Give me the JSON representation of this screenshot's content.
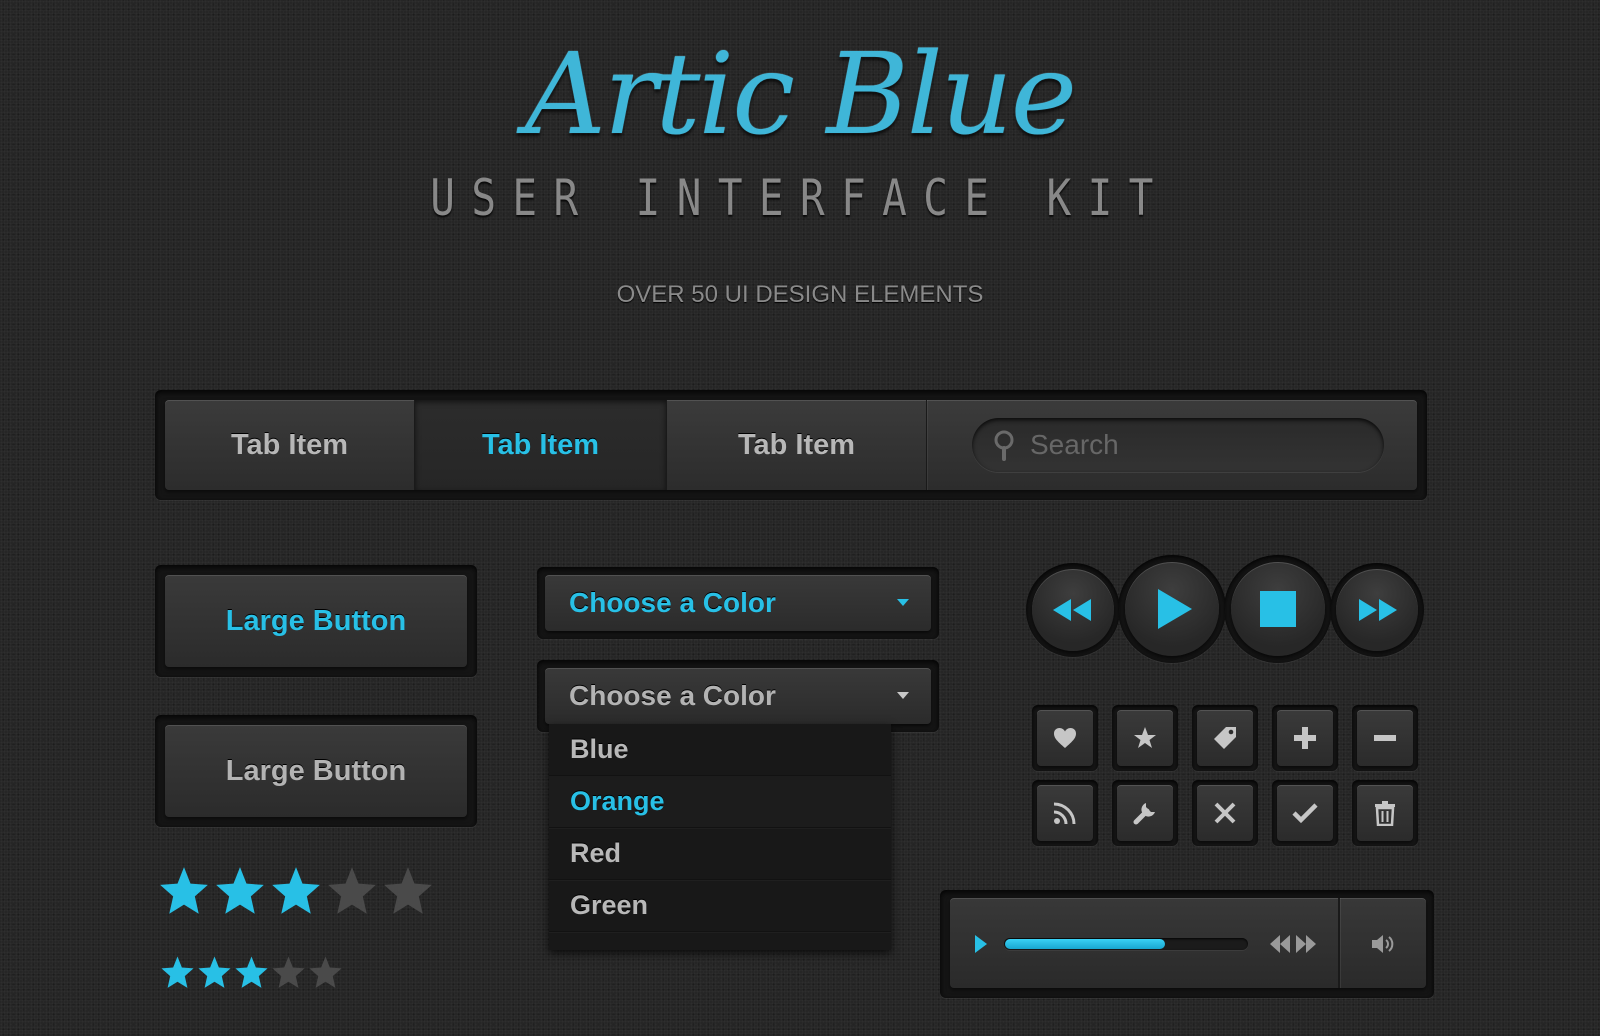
{
  "header": {
    "title": "Artic Blue",
    "subtitle": "USER INTERFACE KIT",
    "tagline": "OVER 50 UI DESIGN ELEMENTS"
  },
  "tabbar": {
    "tabs": [
      {
        "label": "Tab Item",
        "active": false
      },
      {
        "label": "Tab Item",
        "active": true
      },
      {
        "label": "Tab Item",
        "active": false
      }
    ],
    "search": {
      "placeholder": "Search",
      "value": "",
      "icon": "search-icon"
    }
  },
  "buttons": {
    "primary_label": "Large Button",
    "secondary_label": "Large Button"
  },
  "ratings": {
    "large": {
      "filled": 3,
      "total": 5
    },
    "small": {
      "filled": 3,
      "total": 5
    }
  },
  "dropdowns": {
    "primary": {
      "label": "Choose a Color"
    },
    "secondary": {
      "label": "Choose a Color"
    },
    "options": [
      "Blue",
      "Orange",
      "Red",
      "Green"
    ],
    "selected_option": "Orange"
  },
  "media_controls": [
    "rewind-icon",
    "play-icon",
    "stop-icon",
    "fast-forward-icon"
  ],
  "icon_buttons": [
    [
      "heart-icon",
      "star-icon",
      "tag-icon",
      "plus-icon",
      "minus-icon"
    ],
    [
      "rss-icon",
      "wrench-icon",
      "close-icon",
      "check-icon",
      "trash-icon"
    ]
  ],
  "player": {
    "progress_percent": 66,
    "icons": [
      "play-icon",
      "previous-icon",
      "next-icon",
      "volume-icon"
    ]
  },
  "colors": {
    "accent": "#28c0e6",
    "background": "#262626",
    "inactive_star": "#4a4a4a",
    "icon_gray": "#c6c6c6"
  }
}
